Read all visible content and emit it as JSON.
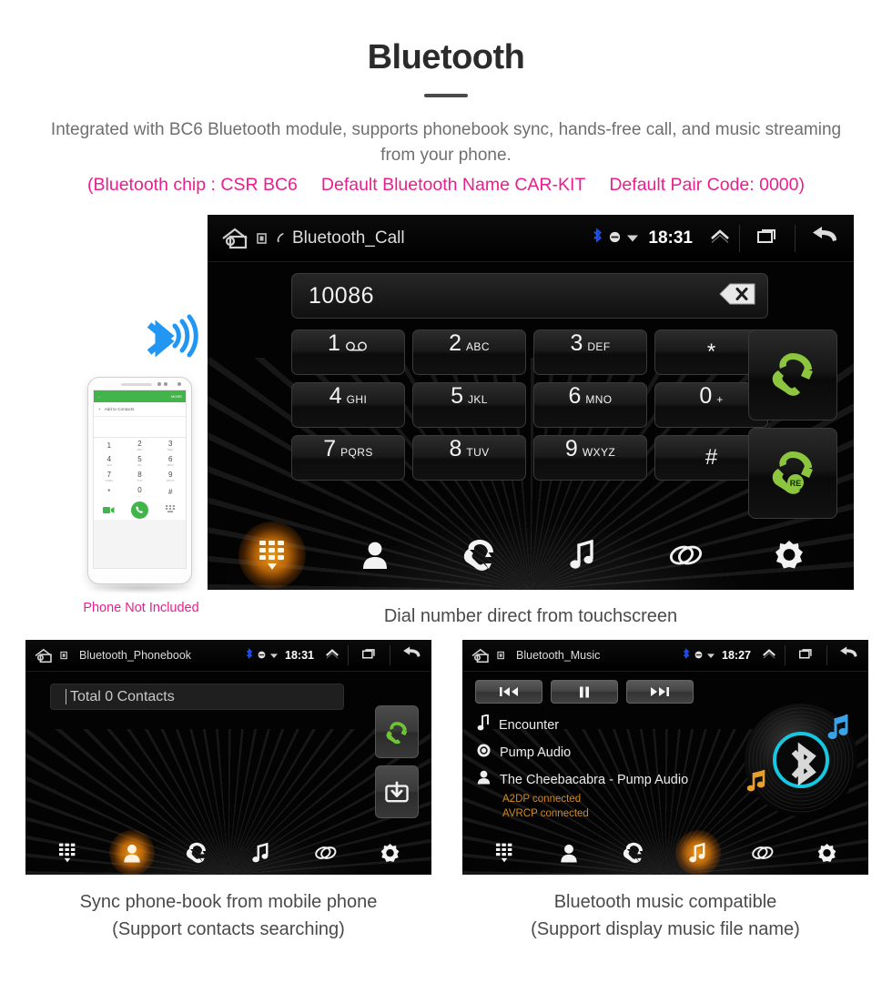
{
  "header": {
    "title": "Bluetooth",
    "subtitle": "Integrated with BC6 Bluetooth module, supports phonebook sync, hands-free call, and music streaming from your phone.",
    "spec_chip": "(Bluetooth chip : CSR BC6",
    "spec_name": "Default Bluetooth Name CAR-KIT",
    "spec_code": "Default Pair Code: 0000)",
    "pink_color": "#ea1e8c"
  },
  "phone_mockup": {
    "note": "Phone Not Included",
    "appbar_more": "MORE",
    "add_contacts": "Add to Contacts",
    "keys": [
      {
        "digit": "1",
        "letters": ""
      },
      {
        "digit": "2",
        "letters": "ABC"
      },
      {
        "digit": "3",
        "letters": "DEF"
      },
      {
        "digit": "4",
        "letters": "GHI"
      },
      {
        "digit": "5",
        "letters": "JKL"
      },
      {
        "digit": "6",
        "letters": "MNO"
      },
      {
        "digit": "7",
        "letters": "PQRS"
      },
      {
        "digit": "8",
        "letters": "TUV"
      },
      {
        "digit": "9",
        "letters": "WXYZ"
      },
      {
        "digit": "*",
        "letters": ""
      },
      {
        "digit": "0",
        "letters": "+"
      },
      {
        "digit": "#",
        "letters": ""
      }
    ]
  },
  "main_screen": {
    "statusbar": {
      "title": "Bluetooth_Call",
      "clock": "18:31",
      "bluetooth_color": "#1b4ff0"
    },
    "dialed_number": "10086",
    "keypad": [
      {
        "digit": "1",
        "letters": "○○",
        "type": "voicemail"
      },
      {
        "digit": "2",
        "letters": "ABC",
        "type": "num"
      },
      {
        "digit": "3",
        "letters": "DEF",
        "type": "num"
      },
      {
        "digit": "*",
        "letters": "",
        "type": "sym"
      },
      {
        "digit": "4",
        "letters": "GHI",
        "type": "num"
      },
      {
        "digit": "5",
        "letters": "JKL",
        "type": "num"
      },
      {
        "digit": "6",
        "letters": "MNO",
        "type": "num"
      },
      {
        "digit": "0",
        "letters": "+",
        "type": "num"
      },
      {
        "digit": "7",
        "letters": "PQRS",
        "type": "num"
      },
      {
        "digit": "8",
        "letters": "TUV",
        "type": "num"
      },
      {
        "digit": "9",
        "letters": "WXYZ",
        "type": "num"
      },
      {
        "digit": "#",
        "letters": "",
        "type": "sym"
      }
    ],
    "call_button": "call",
    "redial_button": "redial",
    "redial_badge": "RE",
    "nav": [
      {
        "name": "dialpad",
        "active": true
      },
      {
        "name": "contacts",
        "active": false
      },
      {
        "name": "call-log",
        "active": false
      },
      {
        "name": "music",
        "active": false
      },
      {
        "name": "pairing",
        "active": false
      },
      {
        "name": "settings",
        "active": false
      }
    ],
    "caption": "Dial number direct from touchscreen"
  },
  "phonebook_screen": {
    "statusbar": {
      "title": "Bluetooth_Phonebook",
      "clock": "18:31"
    },
    "search_value": "Total 0 Contacts",
    "call_button": "call",
    "download_button": "download-contacts",
    "nav": [
      {
        "name": "dialpad",
        "active": false
      },
      {
        "name": "contacts",
        "active": true
      },
      {
        "name": "call-log",
        "active": false
      },
      {
        "name": "music",
        "active": false
      },
      {
        "name": "pairing",
        "active": false
      },
      {
        "name": "settings",
        "active": false
      }
    ],
    "caption_line1": "Sync phone-book from mobile phone",
    "caption_line2": "(Support contacts searching)"
  },
  "music_screen": {
    "statusbar": {
      "title": "Bluetooth_Music",
      "clock": "18:27"
    },
    "transport": [
      {
        "name": "previous",
        "glyph": "⏮"
      },
      {
        "name": "pause",
        "glyph": "⏸"
      },
      {
        "name": "next",
        "glyph": "⏭"
      }
    ],
    "track": {
      "title": "Encounter",
      "album": "Pump Audio",
      "artist": "The Cheebacabra - Pump Audio"
    },
    "status_lines": [
      "A2DP connected",
      "AVRCP connected"
    ],
    "status_color": "#d38b22",
    "nav": [
      {
        "name": "dialpad",
        "active": false
      },
      {
        "name": "contacts",
        "active": false
      },
      {
        "name": "call-log",
        "active": false
      },
      {
        "name": "music",
        "active": true
      },
      {
        "name": "pairing",
        "active": false
      },
      {
        "name": "settings",
        "active": false
      }
    ],
    "caption_line1": "Bluetooth music compatible",
    "caption_line2": "(Support display music file name)"
  }
}
